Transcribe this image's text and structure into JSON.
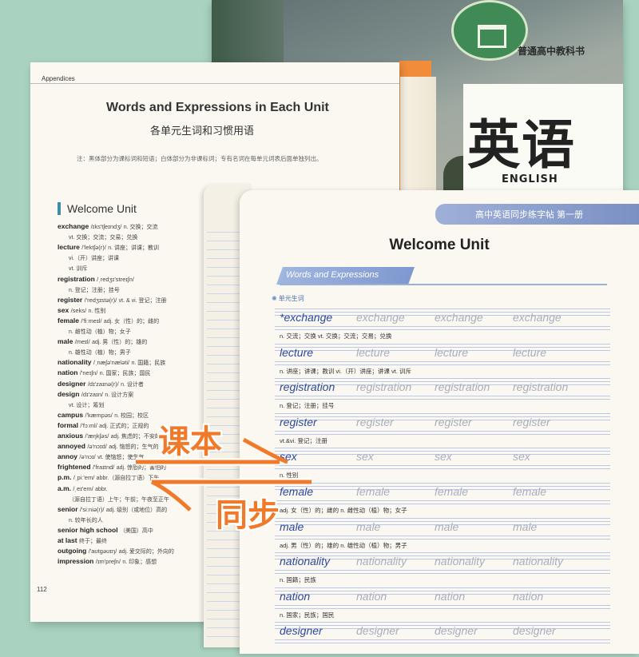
{
  "cover": {
    "series": "普通高中教科书",
    "title_cn": "英语",
    "title_en": "ENGLISH",
    "emblem": "school-emblem"
  },
  "textbook": {
    "header": "Appendices",
    "title": "Words and Expressions in Each Unit",
    "subtitle": "各单元生词和习惯用语",
    "note": "注：黑体部分为课标词和短语；白体部分为非课标词；专有名词在每单元词表后面单独列出。",
    "unit": "Welcome Unit",
    "page": "112",
    "entries": [
      {
        "word": "exchange",
        "phon": "/ɪks'tʃeɪndʒ/",
        "def": "n. 交换；交流"
      },
      {
        "word": "",
        "phon": "",
        "def": "vt. 交换；交流；交易；兑换"
      },
      {
        "word": "lecture",
        "phon": "/'lektʃə(r)/",
        "def": "n. 讲座；讲课；教训"
      },
      {
        "word": "",
        "phon": "",
        "def": "vi.（开）讲座；讲课"
      },
      {
        "word": "",
        "phon": "",
        "def": "vt. 训斥"
      },
      {
        "word": "registration",
        "phon": "/ˌredʒɪ'streɪʃn/",
        "def": ""
      },
      {
        "word": "",
        "phon": "",
        "def": "n. 登记；注册；挂号"
      },
      {
        "word": "register",
        "phon": "/'redʒɪstə(r)/",
        "def": "vt. & vi. 登记；注册"
      },
      {
        "word": "sex",
        "phon": "/seks/",
        "def": "n. 性别"
      },
      {
        "word": "female",
        "phon": "/'fiːmeɪl/",
        "def": "adj. 女（性）的；雌的"
      },
      {
        "word": "",
        "phon": "",
        "def": "n. 雌性动（植）物；女子"
      },
      {
        "word": "male",
        "phon": "/meɪl/",
        "def": "adj. 男（性）的；雄的"
      },
      {
        "word": "",
        "phon": "",
        "def": "n. 雄性动（植）物；男子"
      },
      {
        "word": "nationality",
        "phon": "/ˌnæʃə'næləti/",
        "def": "n. 国籍；民族"
      },
      {
        "word": "nation",
        "phon": "/'neɪʃn/",
        "def": "n. 国家；民族；国民"
      },
      {
        "word": "designer",
        "phon": "/dɪ'zaɪnə(r)/",
        "def": "n. 设计者"
      },
      {
        "word": "design",
        "phon": "/dɪ'zaɪn/",
        "def": "n. 设计方案"
      },
      {
        "word": "",
        "phon": "",
        "def": "vt. 设计；筹划"
      },
      {
        "word": "campus",
        "phon": "/'kæmpəs/",
        "def": "n. 校园；校区"
      },
      {
        "word": "formal",
        "phon": "/'fɔːml/",
        "def": "adj. 正式的；正规的"
      },
      {
        "word": "anxious",
        "phon": "/'æŋkʃəs/",
        "def": "adj. 焦虑的；不安的"
      },
      {
        "word": "annoyed",
        "phon": "/ə'nɔɪd/",
        "def": "adj. 恼怒的；生气的"
      },
      {
        "word": "annoy",
        "phon": "/ə'nɔɪ/",
        "def": "vt. 使恼怒；使生气"
      },
      {
        "word": "frightened",
        "phon": "/'fraɪtnd/",
        "def": "adj. 惊恐的；害怕的"
      },
      {
        "word": "p.m.",
        "phon": "/ˌpiː'em/",
        "def": "abbr.（源自拉丁语）下午"
      },
      {
        "word": "a.m.",
        "phon": "/ˌeɪ'em/",
        "def": "abbr."
      },
      {
        "word": "",
        "phon": "",
        "def": "（源自拉丁语）上午；午前；午夜至正午"
      },
      {
        "word": "senior",
        "phon": "/'siːniə(r)/",
        "def": "adj. 级别（或地位）高的"
      },
      {
        "word": "",
        "phon": "",
        "def": "n. 较年长的人"
      },
      {
        "word": "senior high school",
        "phon": "",
        "def": "（美国）高中"
      },
      {
        "word": "at last",
        "phon": "",
        "def": "终于；最终"
      },
      {
        "word": "outgoing",
        "phon": "/'aʊtgəʊɪŋ/",
        "def": "adj. 爱交际的；外向的"
      },
      {
        "word": "impression",
        "phon": "/ɪm'preʃn/",
        "def": "n. 印象；感想"
      }
    ]
  },
  "workbook": {
    "banner": "高中英语同步练字帖 第一册",
    "title": "Welcome Unit",
    "section": "Words and Expressions",
    "new_words": "单元生词",
    "rows": [
      {
        "word": "*exchange",
        "trace": "exchange",
        "def": "n. 交流；交换 vt. 交换；交流；交易；兑换"
      },
      {
        "word": "lecture",
        "trace": "lecture",
        "def": "n. 讲座；讲课；教训 vi.（开）讲座；讲课 vt. 训斥"
      },
      {
        "word": "registration",
        "trace": "registration",
        "def": "n. 登记；注册；挂号"
      },
      {
        "word": "register",
        "trace": "register",
        "def": "vt.&vi. 登记；注册"
      },
      {
        "word": "sex",
        "trace": "sex",
        "def": "n. 性别"
      },
      {
        "word": "female",
        "trace": "female",
        "def": "adj. 女（性）的；雌的 n. 雌性动（植）物；女子"
      },
      {
        "word": "male",
        "trace": "male",
        "def": "adj. 男（性）的；雄的 n. 雄性动（植）物；男子"
      },
      {
        "word": "nationality",
        "trace": "nationality",
        "def": "n. 国籍；民族"
      },
      {
        "word": "nation",
        "trace": "nation",
        "def": "n. 国家；民族；国民"
      },
      {
        "word": "designer",
        "trace": "designer",
        "def": ""
      }
    ]
  },
  "overlay": {
    "label_textbook": "课本",
    "label_sync": "同步",
    "color": "#f07a2a"
  }
}
